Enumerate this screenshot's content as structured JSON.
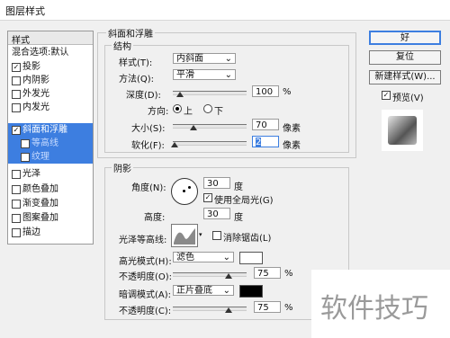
{
  "window": {
    "title": "图层样式"
  },
  "styles_panel": {
    "header": "样式",
    "blend_label": "混合选项:默认",
    "items": [
      {
        "label": "投影",
        "checked": "✓"
      },
      {
        "label": "内阴影",
        "checked": ""
      },
      {
        "label": "外发光",
        "checked": ""
      },
      {
        "label": "内发光",
        "checked": ""
      },
      {
        "label": "斜面和浮雕",
        "checked": "✓"
      },
      {
        "label": "等高线",
        "checked": ""
      },
      {
        "label": "纹理",
        "checked": ""
      },
      {
        "label": "光泽",
        "checked": ""
      },
      {
        "label": "颜色叠加",
        "checked": ""
      },
      {
        "label": "渐变叠加",
        "checked": ""
      },
      {
        "label": "图案叠加",
        "checked": ""
      },
      {
        "label": "描边",
        "checked": ""
      }
    ]
  },
  "bevel": {
    "title": "斜面和浮雕",
    "structure": "结构",
    "style_label": "样式(T):",
    "style_value": "内斜面",
    "method_label": "方法(Q):",
    "method_value": "平滑",
    "depth_label": "深度(D):",
    "depth_value": "100",
    "depth_unit": "%",
    "depth_level": 0.1,
    "direction_label": "方向:",
    "direction_up": "上",
    "direction_down": "下",
    "size_label": "大小(S):",
    "size_value": "70",
    "size_unit": "像素",
    "size_level": 0.28,
    "soften_label": "软化(F):",
    "soften_value": "2",
    "soften_unit": "像素",
    "soften_level": 0.03
  },
  "shading": {
    "title": "阴影",
    "angle_label": "角度(N):",
    "angle_value": "30",
    "angle_unit": "度",
    "global_light_label": "使用全局光(G)",
    "global_light_checked": "✓",
    "altitude_label": "高度:",
    "altitude_value": "30",
    "altitude_unit": "度",
    "gloss_label": "光泽等高线:",
    "antialias_label": "消除锯齿(L)",
    "highlight_label": "高光模式(H):",
    "highlight_value": "滤色",
    "highlight_color": "#ffffff",
    "opacity1_label": "不透明度(O):",
    "opacity1_value": "75",
    "opacity1_unit": "%",
    "opacity1_level": 0.75,
    "shadow_label": "暗调模式(A):",
    "shadow_value": "正片叠底",
    "shadow_color": "#000000",
    "opacity2_label": "不透明度(C):",
    "opacity2_value": "75",
    "opacity2_unit": "%",
    "opacity2_level": 0.75
  },
  "buttons": {
    "ok": "好",
    "reset": "复位",
    "new_style": "新建样式(W)...",
    "preview_label": "预览(V)",
    "preview_checked": "✓"
  },
  "watermark": {
    "text": "软件技巧"
  },
  "colors": {
    "selection": "#3d7ee0"
  }
}
